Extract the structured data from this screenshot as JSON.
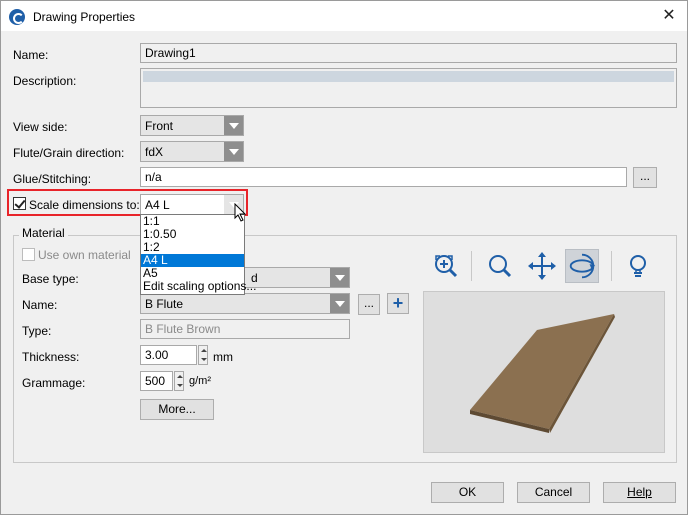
{
  "window": {
    "title": "Drawing Properties",
    "close_glyph": "✕"
  },
  "form": {
    "name_label": "Name:",
    "name_value": "Drawing1",
    "description_label": "Description:",
    "view_side_label": "View side:",
    "view_side_value": "Front",
    "flute_label": "Flute/Grain direction:",
    "flute_value": "fdX",
    "glue_label": "Glue/Stitching:",
    "glue_value": "n/a",
    "glue_browse": "...",
    "scale_label": "Scale dimensions to:",
    "scale_checked": true,
    "scale_value": "A4 L"
  },
  "scale_dropdown": {
    "options": [
      "1:1",
      "1:0.50",
      "1:2",
      "A4 L",
      "A5",
      "Edit scaling options..."
    ],
    "selected_index": 3
  },
  "material": {
    "group_title": "Material",
    "use_own_label": "Use own material",
    "base_type_label": "Base type:",
    "base_type_visible_fragment": "d",
    "name_label": "Name:",
    "name_value": "B Flute",
    "name_browse": "...",
    "name_add": "+",
    "type_label": "Type:",
    "type_value": "B Flute Brown",
    "thickness_label": "Thickness:",
    "thickness_value": "3.00",
    "thickness_unit": "mm",
    "grammage_label": "Grammage:",
    "grammage_value": "500",
    "grammage_unit": "g/m²",
    "more_button": "More..."
  },
  "preview_toolbar": {
    "icons": [
      "zoom-fit-icon",
      "zoom-icon",
      "pan-icon",
      "rotate-icon",
      "light-bulb-icon"
    ],
    "active": "rotate-icon"
  },
  "preview": {
    "board_color": "#8b7050",
    "board_edge_color": "#5e4a33",
    "background": "#dedede"
  },
  "buttons": {
    "ok": "OK",
    "cancel": "Cancel",
    "help": "Help"
  },
  "colors": {
    "highlight": "#e8242a",
    "selection": "#0078d7"
  }
}
